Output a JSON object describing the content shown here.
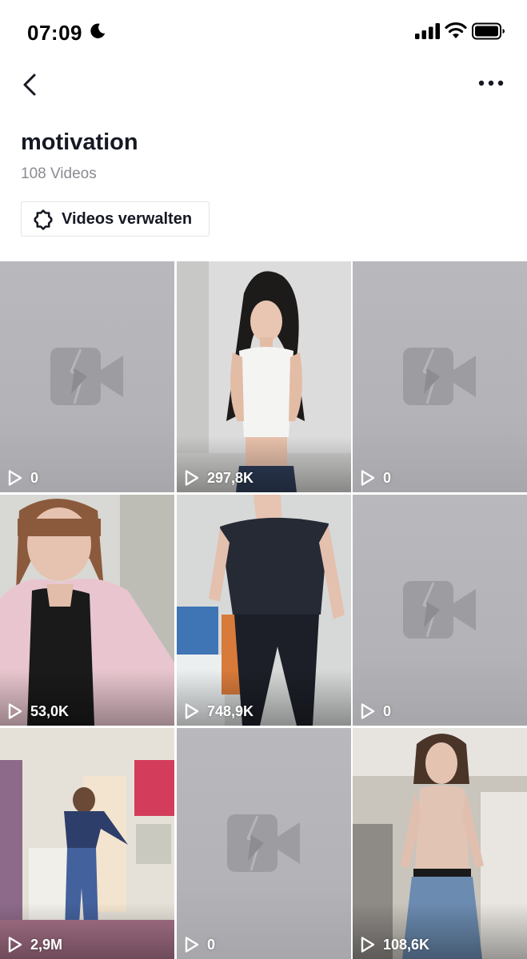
{
  "status_bar": {
    "time": "07:09",
    "icons": [
      "moon-icon",
      "signal-icon",
      "wifi-icon",
      "battery-icon"
    ]
  },
  "nav": {
    "back_icon": "chevron-left-icon",
    "more_icon": "ellipsis-icon"
  },
  "playlist": {
    "title": "motivation",
    "count": "108 Videos"
  },
  "manage_button": {
    "icon": "gear-icon",
    "label": "Videos verwalten"
  },
  "videos": [
    {
      "views": "0",
      "thumbnail": "unavailable"
    },
    {
      "views": "297,8K",
      "thumbnail": "woman-white-tank-top"
    },
    {
      "views": "0",
      "thumbnail": "unavailable"
    },
    {
      "views": "53,0K",
      "thumbnail": "woman-pink-cardigan-selfie"
    },
    {
      "views": "748,9K",
      "thumbnail": "woman-navy-top-hospital"
    },
    {
      "views": "0",
      "thumbnail": "unavailable"
    },
    {
      "views": "2,9M",
      "thumbnail": "woman-dancing-bedroom"
    },
    {
      "views": "0",
      "thumbnail": "unavailable"
    },
    {
      "views": "108,6K",
      "thumbnail": "woman-beige-bodysuit-jeans"
    }
  ],
  "colors": {
    "placeholder": "#b5b5b9",
    "text_primary": "#161823",
    "text_secondary": "#8a8b91",
    "border": "#e3e3e4"
  }
}
